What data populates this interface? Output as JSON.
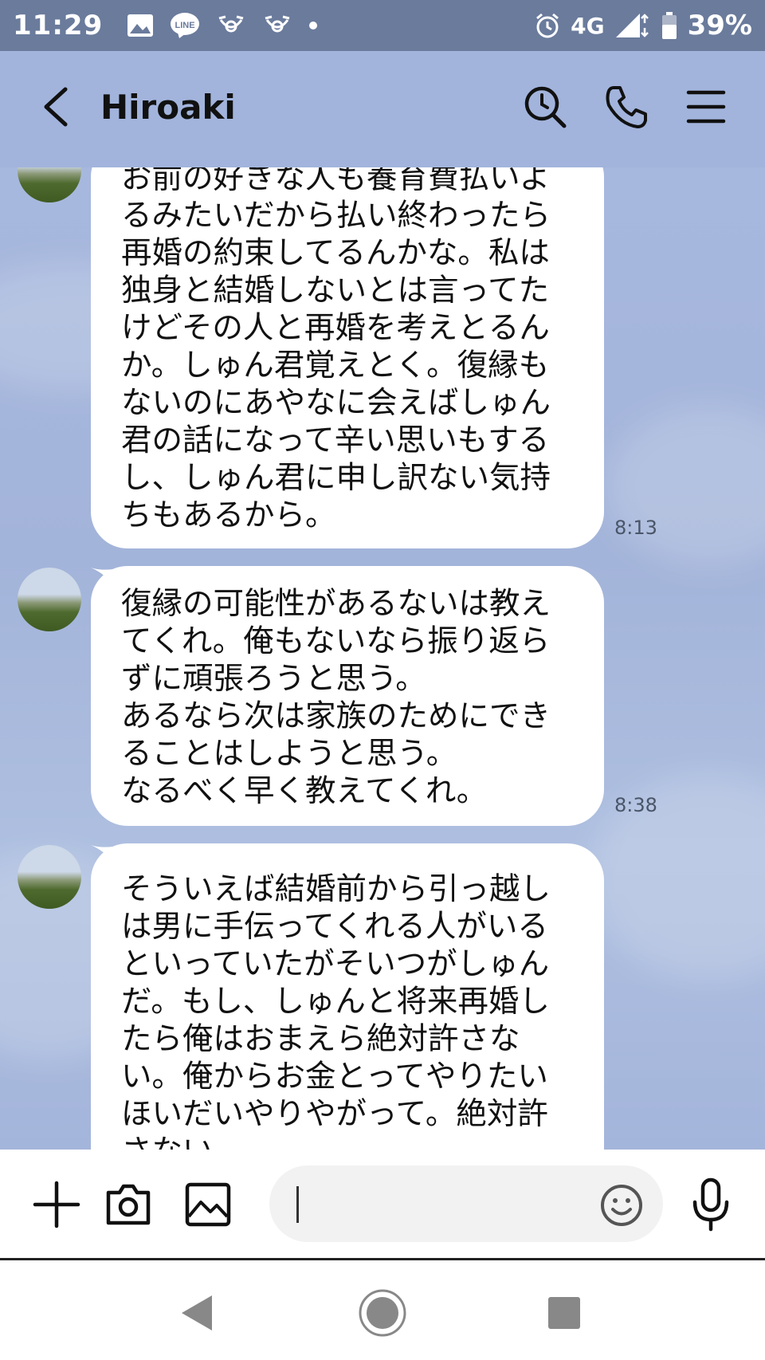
{
  "status_bar": {
    "time": "11:29",
    "network": "4G",
    "battery": "39%"
  },
  "header": {
    "title": "Hiroaki"
  },
  "messages": [
    {
      "lines": [
        "お前の好きな人も養育費払いよ",
        "るみたいだから払い終わったら",
        "再婚の約束してるんかな。私は",
        "独身と結婚しないとは言ってた",
        "けどその人と再婚を考えとるん",
        "か。しゅん君覚えとく。復縁も",
        "ないのにあやなに会えばしゅん",
        "君の話になって辛い思いもする",
        "し、しゅん君に申し訳ない気持",
        "ちもあるから。"
      ],
      "time": "8:13"
    },
    {
      "lines": [
        "復縁の可能性があるないは教え",
        "てくれ。俺もないなら振り返ら",
        "ずに頑張ろうと思う。",
        "あるなら次は家族のためにでき",
        "ることはしようと思う。",
        "なるべく早く教えてくれ。"
      ],
      "time": "8:38"
    },
    {
      "lines": [
        "そういえば結婚前から引っ越し",
        "は男に手伝ってくれる人がいる",
        "といっていたがそいつがしゅん",
        "だ。もし、しゅんと将来再婚し",
        "たら俺はおまえら絶対許さな",
        "い。俺からお金とってやりたい",
        "ほいだいやりやがって。絶対許",
        "さない。"
      ],
      "time": ""
    }
  ],
  "input": {
    "value": "",
    "placeholder": ""
  },
  "colors": {
    "header_bg": "#a2b4dc",
    "status_bg": "#6a7b9c",
    "bubble_bg": "#ffffff"
  }
}
